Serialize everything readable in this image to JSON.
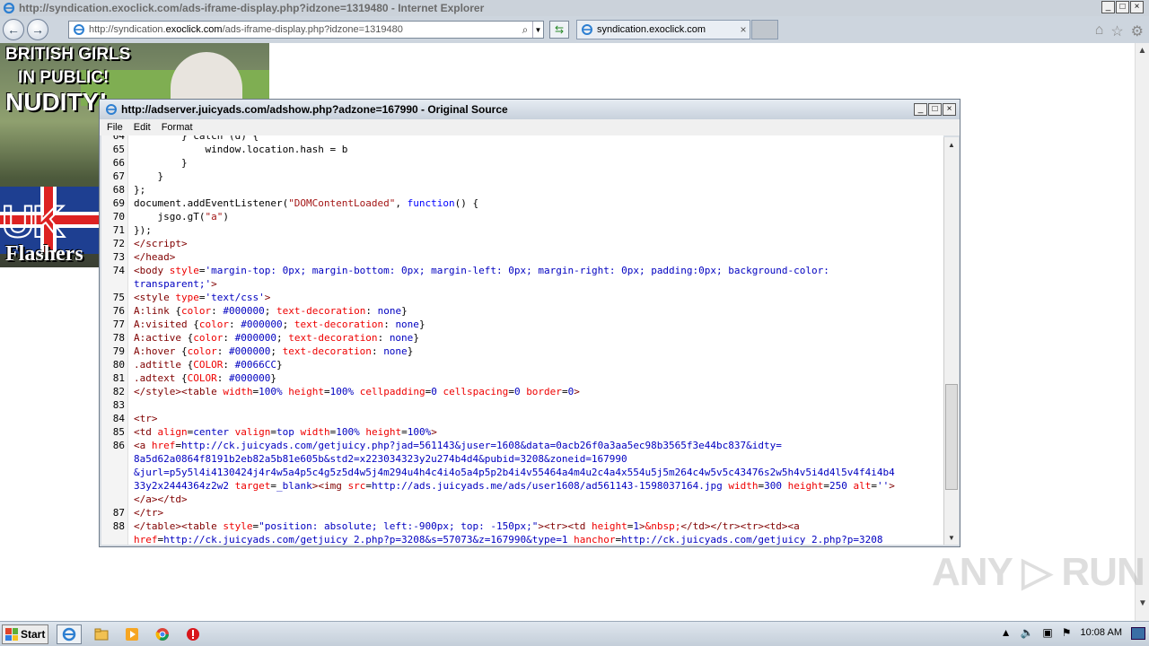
{
  "browser": {
    "window_title": "http://syndication.exoclick.com/ads-iframe-display.php?idzone=1319480 - Internet Explorer",
    "address_prefix": "http://syndication.",
    "address_domain": "exoclick.com",
    "address_suffix": "/ads-iframe-display.php?idzone=1319480",
    "tab_title": "syndication.exoclick.com",
    "search_glyph": "⌕",
    "drop_glyph": "▼",
    "back_glyph": "←",
    "forward_glyph": "→",
    "refresh_glyph": "⇆",
    "close_tab_glyph": "×",
    "home_glyph": "⌂",
    "favorites_glyph": "☆",
    "tools_glyph": "⚙",
    "min_glyph": "_",
    "max_glyph": "□",
    "close_glyph": "×"
  },
  "ad": {
    "line1": "BRITISH GIRLS",
    "line2": "IN PUBLIC!",
    "line3": "NUDITY!",
    "line4": "UK",
    "line5": "Flashers"
  },
  "source_window": {
    "title": "http://adserver.juicyads.com/adshow.php?adzone=167990 - Original Source",
    "menu": [
      "File",
      "Edit",
      "Format"
    ],
    "min_glyph": "_",
    "max_glyph": "□",
    "close_glyph": "×",
    "up_glyph": "▲",
    "down_glyph": "▼"
  },
  "taskbar": {
    "start_label": "Start",
    "clock": "10:08 AM"
  },
  "watermark": "ANY ▷ RUN",
  "colors": {
    "tag": "#800000",
    "attr": "#ee0000",
    "value": "#0000c0",
    "keyword": "#0000ff"
  }
}
